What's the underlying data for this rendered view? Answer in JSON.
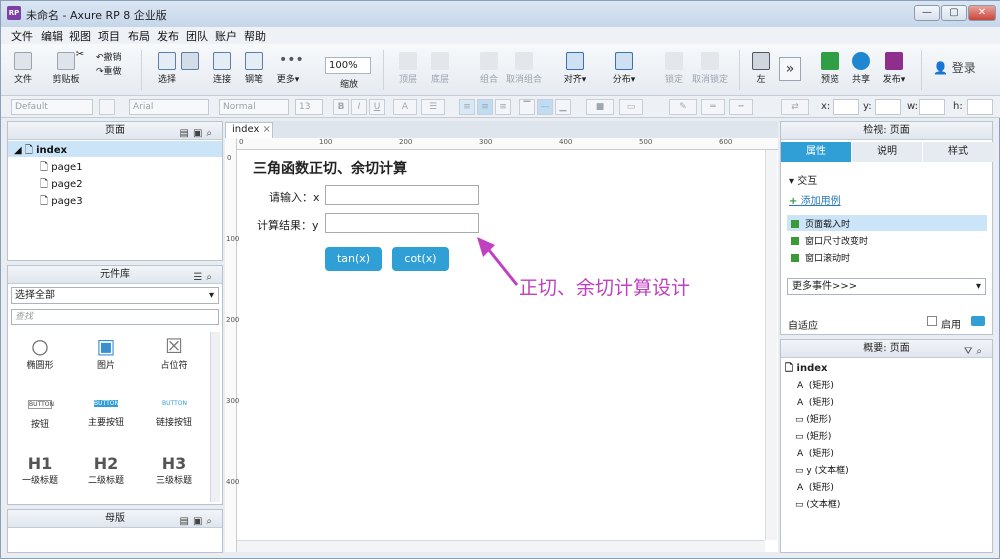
{
  "window": {
    "title": "未命名 - Axure RP 8 企业版",
    "icon_text": "RP",
    "btn_min": "—",
    "btn_max": "▢",
    "btn_close": "✕"
  },
  "menu": [
    "文件",
    "编辑",
    "视图",
    "项目",
    "布局",
    "发布",
    "团队",
    "账户",
    "帮助"
  ],
  "toolbar": {
    "file": "文件",
    "clipboard": "剪贴板",
    "cut": "✂",
    "undo": "撤销",
    "redo": "重做",
    "select": "选择",
    "connect": "连接",
    "pen": "钢笔",
    "more": "更多▾",
    "zoom_value": "100%",
    "zoom_label": "缩放",
    "top": "顶层",
    "bottom": "底层",
    "group": "组合",
    "ungroup": "取消组合",
    "align": "对齐▾",
    "distribute": "分布▾",
    "lock": "锁定",
    "unlock": "取消锁定",
    "left": "左",
    "expand": "»",
    "preview": "预览",
    "share": "共享",
    "publish": "发布▾",
    "login": "登录"
  },
  "format": {
    "style": "Default",
    "font": "Arial",
    "weight": "Normal",
    "size": "13",
    "x_label": "x:",
    "y_label": "y:",
    "w_label": "w:",
    "h_label": "h:"
  },
  "pages_panel": {
    "title": "页面",
    "items": [
      "index",
      "page1",
      "page2",
      "page3"
    ]
  },
  "library": {
    "title": "元件库",
    "select_all": "选择全部",
    "search_placeholder": "查找",
    "items": [
      {
        "label": "椭圆形",
        "glyph": "○"
      },
      {
        "label": "图片",
        "glyph": "▣"
      },
      {
        "label": "占位符",
        "glyph": "☒"
      },
      {
        "label": "按钮",
        "glyph": "BUTTON"
      },
      {
        "label": "主要按钮",
        "glyph": "BUTTON"
      },
      {
        "label": "链接按钮",
        "glyph": "BUTTON"
      },
      {
        "label": "一级标题",
        "glyph": "H1"
      },
      {
        "label": "二级标题",
        "glyph": "H2"
      },
      {
        "label": "三级标题",
        "glyph": "H3"
      }
    ]
  },
  "masters": {
    "title": "母版"
  },
  "tab": {
    "label": "index",
    "close": "×"
  },
  "ruler": {
    "h": [
      "0",
      "100",
      "200",
      "300",
      "400",
      "500",
      "600"
    ],
    "v": [
      "0",
      "100",
      "200",
      "300",
      "400"
    ]
  },
  "canvas": {
    "heading": "三角函数正切、余切计算",
    "label_x": "请输入：x",
    "label_y": "计算结果：y",
    "btn_tan": "tan(x)",
    "btn_cot": "cot(x)",
    "annotation": "正切、余切计算设计"
  },
  "inspector": {
    "title": "检视: 页面",
    "tabs": [
      "属性",
      "说明",
      "样式"
    ],
    "section": "交互",
    "add_case": "添加用例",
    "events": [
      "页面载入时",
      "窗口尺寸改变时",
      "窗口滚动时"
    ],
    "more_events": "更多事件>>>",
    "adaptive": "自适应",
    "enable": "启用"
  },
  "outline": {
    "title": "概要: 页面",
    "root": "index",
    "items": [
      "(矩形)",
      "(矩形)",
      "(矩形)",
      "(矩形)",
      "(矩形)",
      "y (文本框)",
      "(矩形)",
      "(文本框)"
    ]
  },
  "colors": {
    "accent": "#2f9fd6",
    "annotation": "#c040c0",
    "selected": "#cce4f7"
  }
}
